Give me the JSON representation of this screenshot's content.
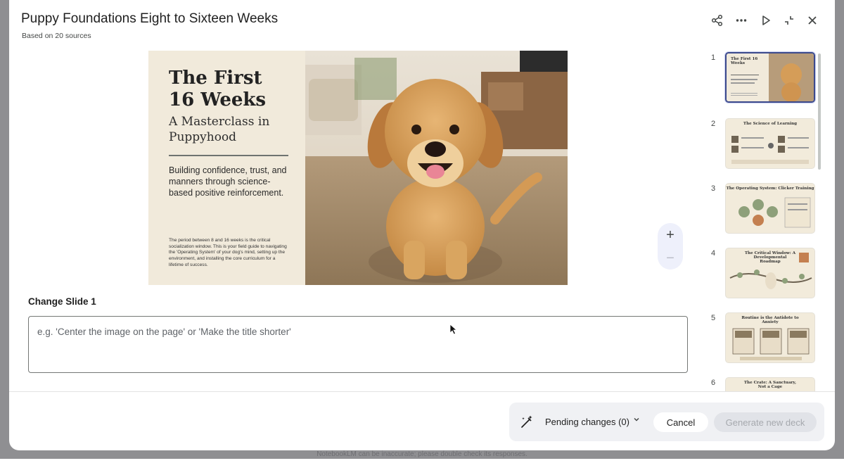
{
  "dialog": {
    "title": "Puppy Foundations Eight to Sixteen Weeks",
    "subtitle": "Based on 20 sources",
    "header_icons": [
      "share-icon",
      "more-icon",
      "play-icon",
      "collapse-icon",
      "close-icon"
    ]
  },
  "slide": {
    "title_line1": "The First",
    "title_line2": "16 Weeks",
    "subtitle_line1": "A Masterclass in",
    "subtitle_line2": "Puppyhood",
    "body": "Building confidence, trust, and manners through science-based positive reinforcement.",
    "small_text": "The period between 8 and 16 weeks is the critical socialization window. This is your field guide to navigating the 'Operating System' of your dog's mind, setting up the environment, and installing the core curriculum for a lifetime of success."
  },
  "zoom": {
    "plus": "+",
    "minus": "−"
  },
  "change": {
    "label": "Change Slide 1",
    "placeholder": "e.g. 'Center the image on the page' or 'Make the title shorter'"
  },
  "thumbnails": [
    {
      "number": "1",
      "title": "The First 16 Weeks"
    },
    {
      "number": "2",
      "title": "The Science of Learning"
    },
    {
      "number": "3",
      "title": "The Operating System: Clicker Training"
    },
    {
      "number": "4",
      "title": "The Critical Window: A Developmental Roadmap"
    },
    {
      "number": "5",
      "title": "Routine is the Antidote to Anxiety"
    },
    {
      "number": "6",
      "title": "The Crate: A Sanctuary, Not a Cage"
    }
  ],
  "footer": {
    "pending_label": "Pending changes (0)",
    "cancel_label": "Cancel",
    "generate_label": "Generate new deck"
  },
  "disclaimer": "NotebookLM can be inaccurate; please double check its responses.",
  "colors": {
    "accent": "#3c4a8c",
    "slide_bg": "#f1eadb"
  }
}
